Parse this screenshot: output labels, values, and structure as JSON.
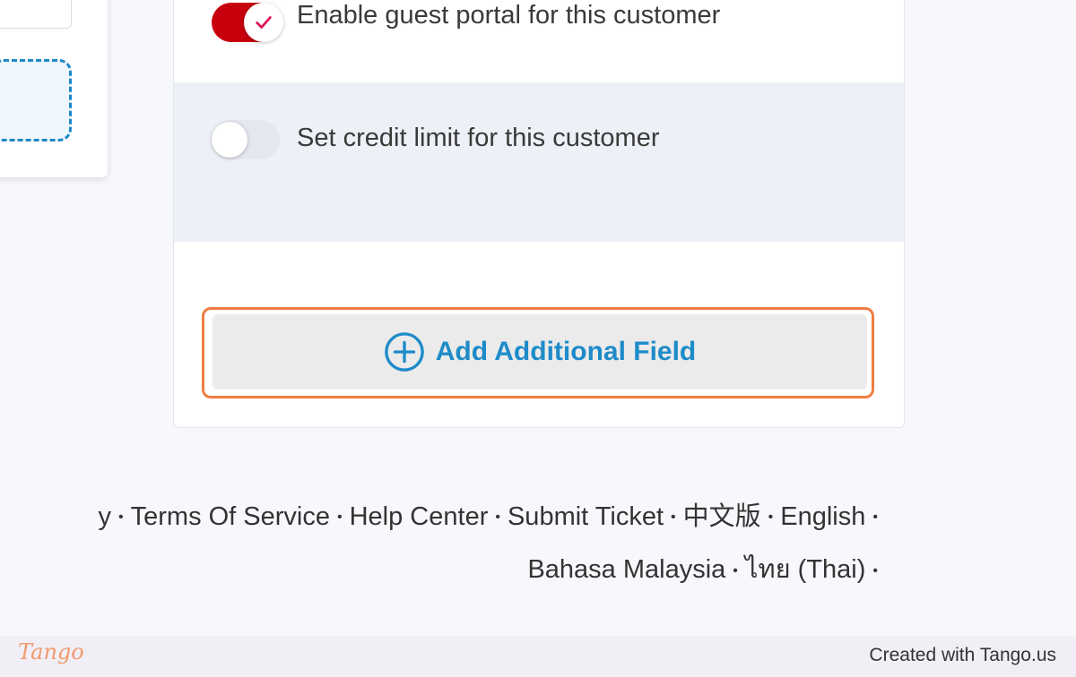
{
  "settings": {
    "guest_portal_label": "Enable guest portal for this customer",
    "guest_portal_enabled": true,
    "credit_limit_label": "Set credit limit for this customer",
    "credit_limit_enabled": false
  },
  "add_field_button": {
    "label": "Add Additional Field",
    "icon": "plus-circle-icon"
  },
  "footer": {
    "line1": [
      "y",
      "Terms Of Service",
      "Help Center",
      "Submit Ticket",
      "中文版",
      "English"
    ],
    "line2": [
      "Bahasa Malaysia",
      "ไทย (Thai)"
    ],
    "separator": "•"
  },
  "tango": {
    "logo": "Tango",
    "credit": "Created with Tango.us"
  },
  "colors": {
    "toggle_on": "#c8000e",
    "accent_blue": "#1e8bc9",
    "highlight": "#ef7d42"
  }
}
